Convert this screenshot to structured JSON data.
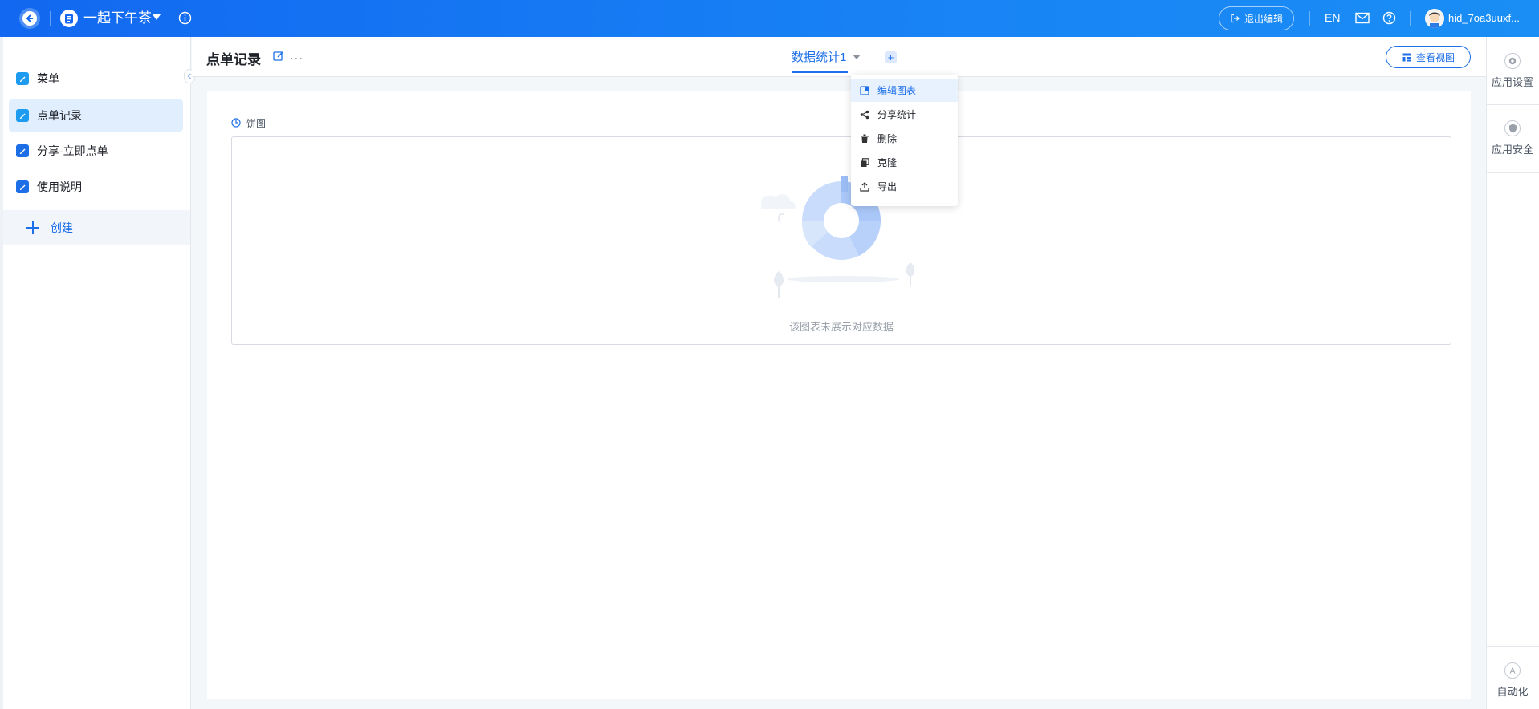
{
  "header": {
    "app_name": "一起下午茶",
    "exit_edit_label": "退出编辑",
    "lang_label": "EN",
    "user_name": "hid_7oa3uuxf..."
  },
  "sidebar": {
    "items": [
      {
        "label": "菜单"
      },
      {
        "label": "点单记录"
      },
      {
        "label": "分享-立即点单"
      },
      {
        "label": "使用说明"
      }
    ],
    "create_label": "创建"
  },
  "page": {
    "title": "点单记录",
    "more_label": "···",
    "active_tab": "数据统计1",
    "add_tab_label": "+",
    "view_button_label": "查看视图"
  },
  "right_panel": {
    "app_settings": "应用设置",
    "app_security": "应用安全",
    "automation": "自动化"
  },
  "chart": {
    "label": "饼图",
    "empty_text": "该图表未展示对应数据"
  },
  "dropdown": {
    "items": [
      {
        "label": "编辑图表"
      },
      {
        "label": "分享统计"
      },
      {
        "label": "删除"
      },
      {
        "label": "克隆"
      },
      {
        "label": "导出"
      }
    ]
  },
  "colors": {
    "accent": "#1d6fe8",
    "topbar": "#1883f5",
    "active_nav_bg": "#e1eefe"
  }
}
